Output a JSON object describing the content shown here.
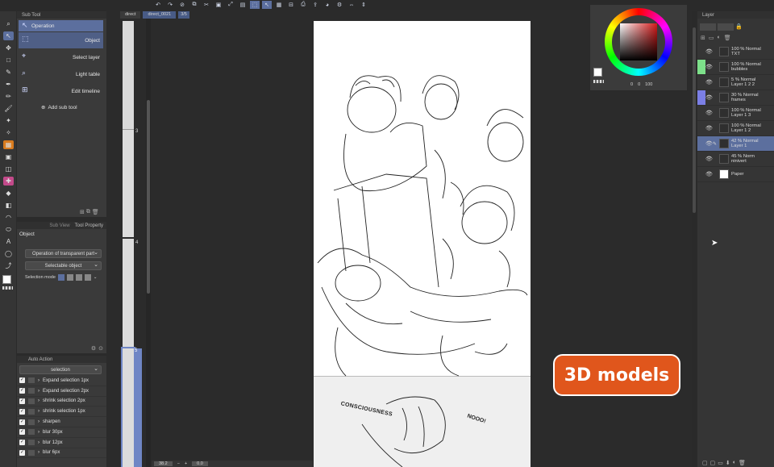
{
  "subtool": {
    "header": "Sub Tool",
    "items": [
      {
        "label": "Operation",
        "icon": "cursor-icon"
      },
      {
        "label": "Object",
        "icon": "object-select-icon"
      },
      {
        "label": "Select layer",
        "icon": "select-layer-icon"
      },
      {
        "label": "Light table",
        "icon": "light-table-icon"
      },
      {
        "label": "Edit timeline",
        "icon": "timeline-icon"
      }
    ],
    "add_label": "Add sub tool"
  },
  "tool_property": {
    "tabs": [
      "Sub View",
      "Tool Property"
    ],
    "title": "Object",
    "dropdown1": "Operation of transparent part",
    "dropdown2": "Selectable object",
    "selection_mode_label": "Selection mode"
  },
  "auto_action": {
    "tab": "Auto Action",
    "set": "selection",
    "items": [
      "Expand selection 1px",
      "Expand selection 2px",
      "shrink selection 2px",
      "shrink selection 1px",
      "sharpen",
      "blur 30px",
      "blur 12px",
      "blur 6px"
    ]
  },
  "canvas_tabs": [
    "direct",
    "direct_0021",
    "3/5"
  ],
  "page_numbers": [
    "3",
    "4",
    "5"
  ],
  "status": {
    "zoom": "38.2",
    "angle": "0.0"
  },
  "sketch": {
    "text1": "CONSCIOUSNESS",
    "text2": "NOOO!"
  },
  "color": {
    "label1": "0",
    "label2": "0",
    "label3": "100",
    "accent": "#d85a1f"
  },
  "layers": {
    "header": "Layer",
    "rows": [
      {
        "line1": "100 % Normal",
        "line2": "TXT",
        "color": ""
      },
      {
        "line1": "100 % Normal",
        "line2": "bubbles",
        "color": "#7de08a"
      },
      {
        "line1": "5 % Normal",
        "line2": "Layer 1 2 2",
        "color": ""
      },
      {
        "line1": "30 % Normal",
        "line2": "frames",
        "color": "#7b7fe6"
      },
      {
        "line1": "100 % Normal",
        "line2": "Layer 1 3",
        "color": ""
      },
      {
        "line1": "100 % Normal",
        "line2": "Layer 1 2",
        "color": ""
      },
      {
        "line1": "42 % Normal",
        "line2": "Layer 1",
        "color": ""
      },
      {
        "line1": "45 % Norm",
        "line2": "ninivert",
        "color": ""
      },
      {
        "line1": "",
        "line2": "Paper",
        "color": ""
      }
    ]
  },
  "badge": {
    "label": "3D models",
    "color": "#e0561c"
  }
}
